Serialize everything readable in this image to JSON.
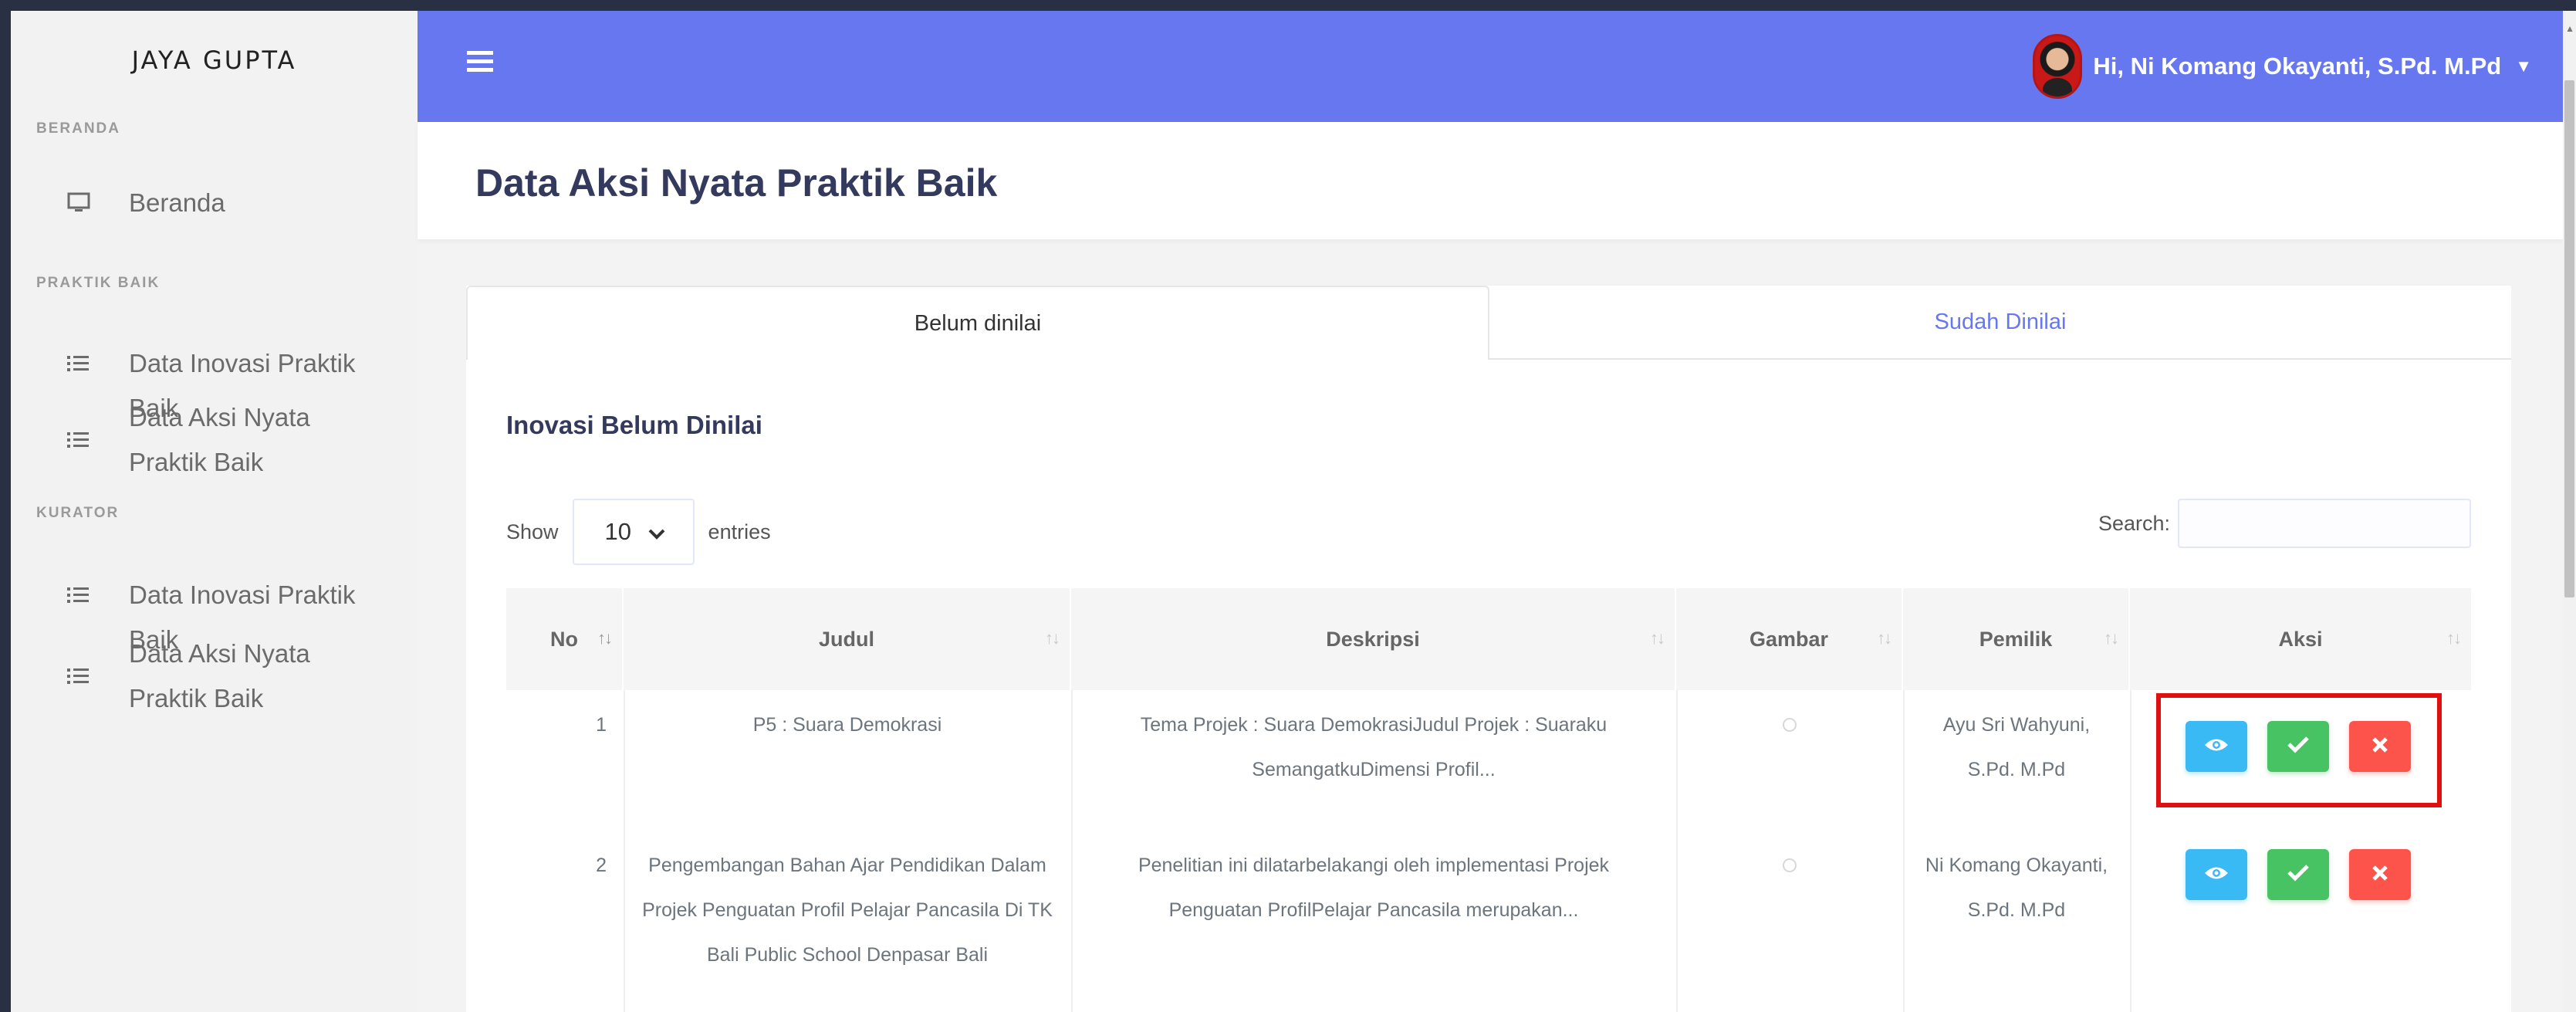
{
  "brand": "JAYA GUPTA",
  "sidebar": {
    "sections": [
      {
        "label": "BERANDA",
        "items": [
          {
            "label": "Beranda",
            "icon": "monitor-icon"
          }
        ]
      },
      {
        "label": "PRAKTIK BAIK",
        "items": [
          {
            "label": "Data Inovasi Praktik Baik",
            "icon": "list-icon"
          },
          {
            "label": "Data Aksi Nyata Praktik Baik",
            "icon": "list-icon"
          }
        ]
      },
      {
        "label": "KURATOR",
        "items": [
          {
            "label": "Data Inovasi Praktik Baik",
            "icon": "list-icon"
          },
          {
            "label": "Data Aksi Nyata Praktik Baik",
            "icon": "list-icon"
          }
        ]
      }
    ]
  },
  "header": {
    "user_greeting": "Hi, Ni Komang Okayanti, S.Pd. M.Pd",
    "accent_color": "#6777ef"
  },
  "page": {
    "title": "Data Aksi Nyata Praktik Baik"
  },
  "tabs": [
    {
      "label": "Belum dinilai",
      "active": true
    },
    {
      "label": "Sudah Dinilai",
      "active": false
    }
  ],
  "card": {
    "subtitle": "Inovasi Belum Dinilai",
    "show_label": "Show",
    "entries_value": "10",
    "entries_label": "entries",
    "search_label": "Search:",
    "search_value": ""
  },
  "table": {
    "columns": [
      "No",
      "Judul",
      "Deskripsi",
      "Gambar",
      "Pemilik",
      "Aksi"
    ],
    "rows": [
      {
        "no": "1",
        "judul": "P5 : Suara Demokrasi",
        "deskripsi": "Tema Projek : Suara DemokrasiJudul Projek : Suaraku SemangatkuDimensi Profil...",
        "pemilik": "Ayu Sri Wahyuni, S.Pd. M.Pd"
      },
      {
        "no": "2",
        "judul": "Pengembangan Bahan Ajar Pendidikan Dalam Projek Penguatan Profil Pelajar Pancasila Di TK Bali Public School Denpasar Bali",
        "deskripsi": "Penelitian ini dilatarbelakangi oleh implementasi Projek Penguatan ProfilPelajar Pancasila merupakan...",
        "pemilik": "Ni Komang Okayanti, S.Pd. M.Pd"
      }
    ],
    "action_icons": [
      "eye-icon",
      "check-icon",
      "close-icon"
    ]
  }
}
